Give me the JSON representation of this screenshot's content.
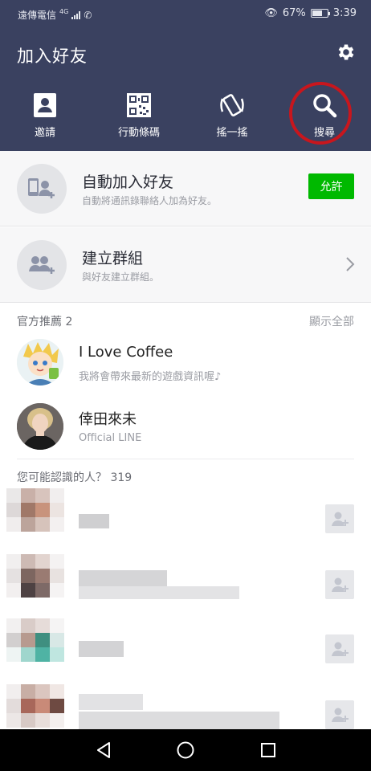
{
  "status": {
    "carrier": "遠傳電信",
    "network": "4G",
    "battery": "67%",
    "time": "3:39"
  },
  "header": {
    "title": "加入好友",
    "actions": [
      {
        "label": "邀請",
        "icon": "contact-card-icon"
      },
      {
        "label": "行動條碼",
        "icon": "qr-code-icon"
      },
      {
        "label": "搖一搖",
        "icon": "shake-phone-icon"
      },
      {
        "label": "搜尋",
        "icon": "search-icon"
      }
    ]
  },
  "auto_add": {
    "title": "自動加入好友",
    "subtitle": "自動將通訊錄聯絡人加為好友。",
    "button": "允許"
  },
  "create_group": {
    "title": "建立群組",
    "subtitle": "與好友建立群組。"
  },
  "official": {
    "heading": "官方推薦 2",
    "show_all": "顯示全部",
    "items": [
      {
        "name": "I Love Coffee",
        "subtitle": "我將會帶來最新的遊戲資訊喔♪"
      },
      {
        "name": "倖田來未",
        "subtitle": "Official LINE"
      }
    ]
  },
  "people": {
    "heading": "您可能認識的人？ 319"
  },
  "colors": {
    "header_bg": "#3a4160",
    "accent_green": "#00b900",
    "highlight_red": "#c8161d"
  }
}
